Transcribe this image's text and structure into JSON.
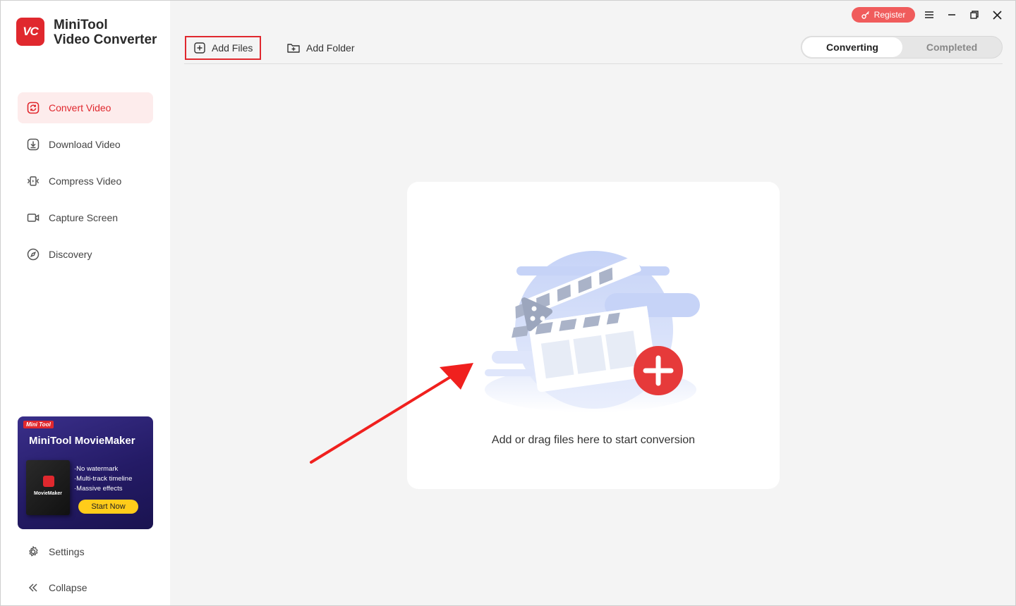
{
  "app": {
    "name_line1": "MiniTool",
    "name_line2": "Video Converter",
    "logo_text": "VC",
    "accent_color": "#e0282e"
  },
  "sidebar": {
    "items": [
      {
        "label": "Convert Video",
        "icon": "convert-icon",
        "active": true
      },
      {
        "label": "Download Video",
        "icon": "download-icon",
        "active": false
      },
      {
        "label": "Compress Video",
        "icon": "compress-icon",
        "active": false
      },
      {
        "label": "Capture Screen",
        "icon": "camera-icon",
        "active": false
      },
      {
        "label": "Discovery",
        "icon": "compass-icon",
        "active": false
      }
    ],
    "promo": {
      "tag": "Mini Tool",
      "title": "MiniTool MovieMaker",
      "box_label": "MovieMaker",
      "features": [
        "No watermark",
        "Multi-track timeline",
        "Massive effects"
      ],
      "cta": "Start Now"
    },
    "settings_label": "Settings",
    "collapse_label": "Collapse"
  },
  "toolbar": {
    "add_files": "Add Files",
    "add_folder": "Add Folder"
  },
  "tabs": {
    "converting": "Converting",
    "completed": "Completed",
    "active": "converting"
  },
  "titlebar": {
    "register": "Register"
  },
  "drop_area": {
    "hint": "Add or drag files here to start conversion"
  }
}
